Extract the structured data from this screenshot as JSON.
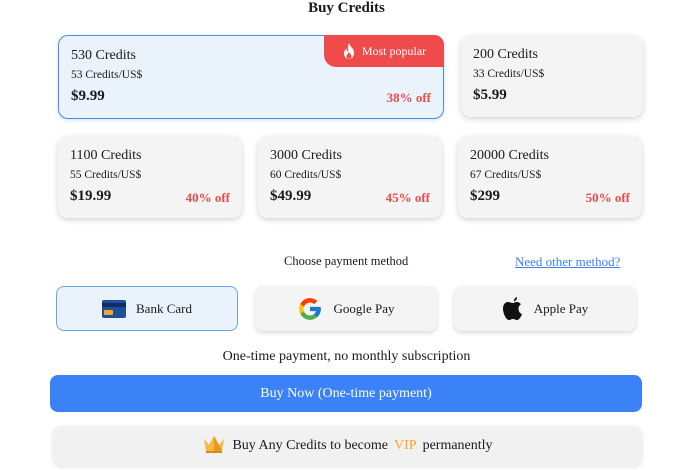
{
  "title": "Buy Credits",
  "badge": {
    "label": "Most popular",
    "icon": "fire-icon"
  },
  "plans": [
    {
      "credits": "530 Credits",
      "rate": "53 Credits/US$",
      "price": "$9.99",
      "off": "38% off",
      "selected": true
    },
    {
      "credits": "200 Credits",
      "rate": "33 Credits/US$",
      "price": "$5.99",
      "off": ""
    },
    {
      "credits": "1100 Credits",
      "rate": "55 Credits/US$",
      "price": "$19.99",
      "off": "40% off"
    },
    {
      "credits": "3000 Credits",
      "rate": "60 Credits/US$",
      "price": "$49.99",
      "off": "45% off"
    },
    {
      "credits": "20000 Credits",
      "rate": "67 Credits/US$",
      "price": "$299",
      "off": "50% off"
    }
  ],
  "payment": {
    "label": "Choose payment method",
    "other_link": "Need other method?",
    "methods": [
      {
        "label": "Bank Card",
        "icon": "credit-card-icon",
        "selected": true
      },
      {
        "label": "Google Pay",
        "icon": "google-icon"
      },
      {
        "label": "Apple Pay",
        "icon": "apple-icon"
      }
    ]
  },
  "note": "One-time payment, no monthly subscription",
  "buy_button": "Buy Now (One-time payment)",
  "vip": {
    "prefix": "Buy Any Credits to become",
    "highlight": "VIP",
    "suffix": "permanently",
    "icon": "crown-icon"
  },
  "colors": {
    "accent": "#3b82f6",
    "discount": "#e94b4b",
    "badge": "#ef4b4b",
    "vip": "#f5a623"
  }
}
